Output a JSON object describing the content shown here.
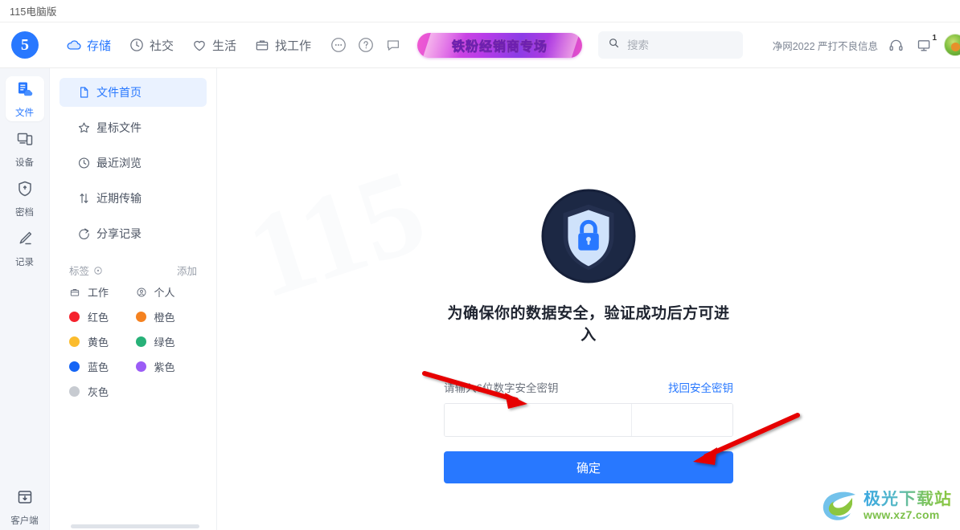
{
  "window": {
    "title": "115电脑版"
  },
  "topnav": {
    "logo": "5",
    "items": [
      {
        "label": "存储",
        "icon": "cloud-icon",
        "active": true
      },
      {
        "label": "社交",
        "icon": "clock-icon",
        "active": false
      },
      {
        "label": "生活",
        "icon": "heart-icon",
        "active": false
      },
      {
        "label": "找工作",
        "icon": "briefcase-icon",
        "active": false
      }
    ],
    "round_icons": [
      "more-icon",
      "help-icon",
      "message-icon"
    ],
    "promo": {
      "text": "铁粉经销商专场"
    },
    "search": {
      "value": "",
      "placeholder": "搜索"
    },
    "notice": "净网2022 严打不良信息",
    "right_icons": [
      "headphone-icon",
      "monitor-icon",
      "avatar"
    ],
    "monitor_badge": "1"
  },
  "rail": {
    "items": [
      {
        "label": "文件",
        "icon": "files-icon",
        "active": true
      },
      {
        "label": "设备",
        "icon": "devices-icon",
        "active": false
      },
      {
        "label": "密档",
        "icon": "vault-icon",
        "active": false
      },
      {
        "label": "记录",
        "icon": "notes-icon",
        "active": false
      }
    ],
    "bottom": {
      "label": "客户端",
      "icon": "download-box-icon"
    }
  },
  "sidebar": {
    "items": [
      {
        "label": "文件首页",
        "icon": "document-icon",
        "active": true
      },
      {
        "label": "星标文件",
        "icon": "star-icon",
        "active": false
      },
      {
        "label": "最近浏览",
        "icon": "history-icon",
        "active": false
      },
      {
        "label": "近期传输",
        "icon": "transfer-icon",
        "active": false
      },
      {
        "label": "分享记录",
        "icon": "share-icon",
        "active": false
      }
    ],
    "tags_header": {
      "label": "标签",
      "add_label": "添加"
    },
    "tags": [
      {
        "label": "工作",
        "type": "icon",
        "icon": "briefcase-icon"
      },
      {
        "label": "个人",
        "type": "icon",
        "icon": "person-icon"
      },
      {
        "label": "红色",
        "type": "dot",
        "color": "#f5222d"
      },
      {
        "label": "橙色",
        "type": "dot",
        "color": "#f58220"
      },
      {
        "label": "黄色",
        "type": "dot",
        "color": "#fbbc2e"
      },
      {
        "label": "绿色",
        "type": "dot",
        "color": "#27b178"
      },
      {
        "label": "蓝色",
        "type": "dot",
        "color": "#1565f5"
      },
      {
        "label": "紫色",
        "type": "dot",
        "color": "#9b5cf6"
      },
      {
        "label": "灰色",
        "type": "dot",
        "color": "#c7cbd1"
      }
    ]
  },
  "main": {
    "shield_icon": "shield-lock-icon",
    "title": "为确保你的数据安全，验证成功后方可进入",
    "hint_left": "请输入6位数字安全密钥",
    "hint_right": "找回安全密钥",
    "code_cells": [
      "",
      "",
      "",
      "",
      "",
      ""
    ],
    "confirm_label": "确定",
    "accent_color": "#2878ff"
  },
  "watermark": {
    "cn": "极光下载站",
    "url": "www.xz7.com"
  }
}
